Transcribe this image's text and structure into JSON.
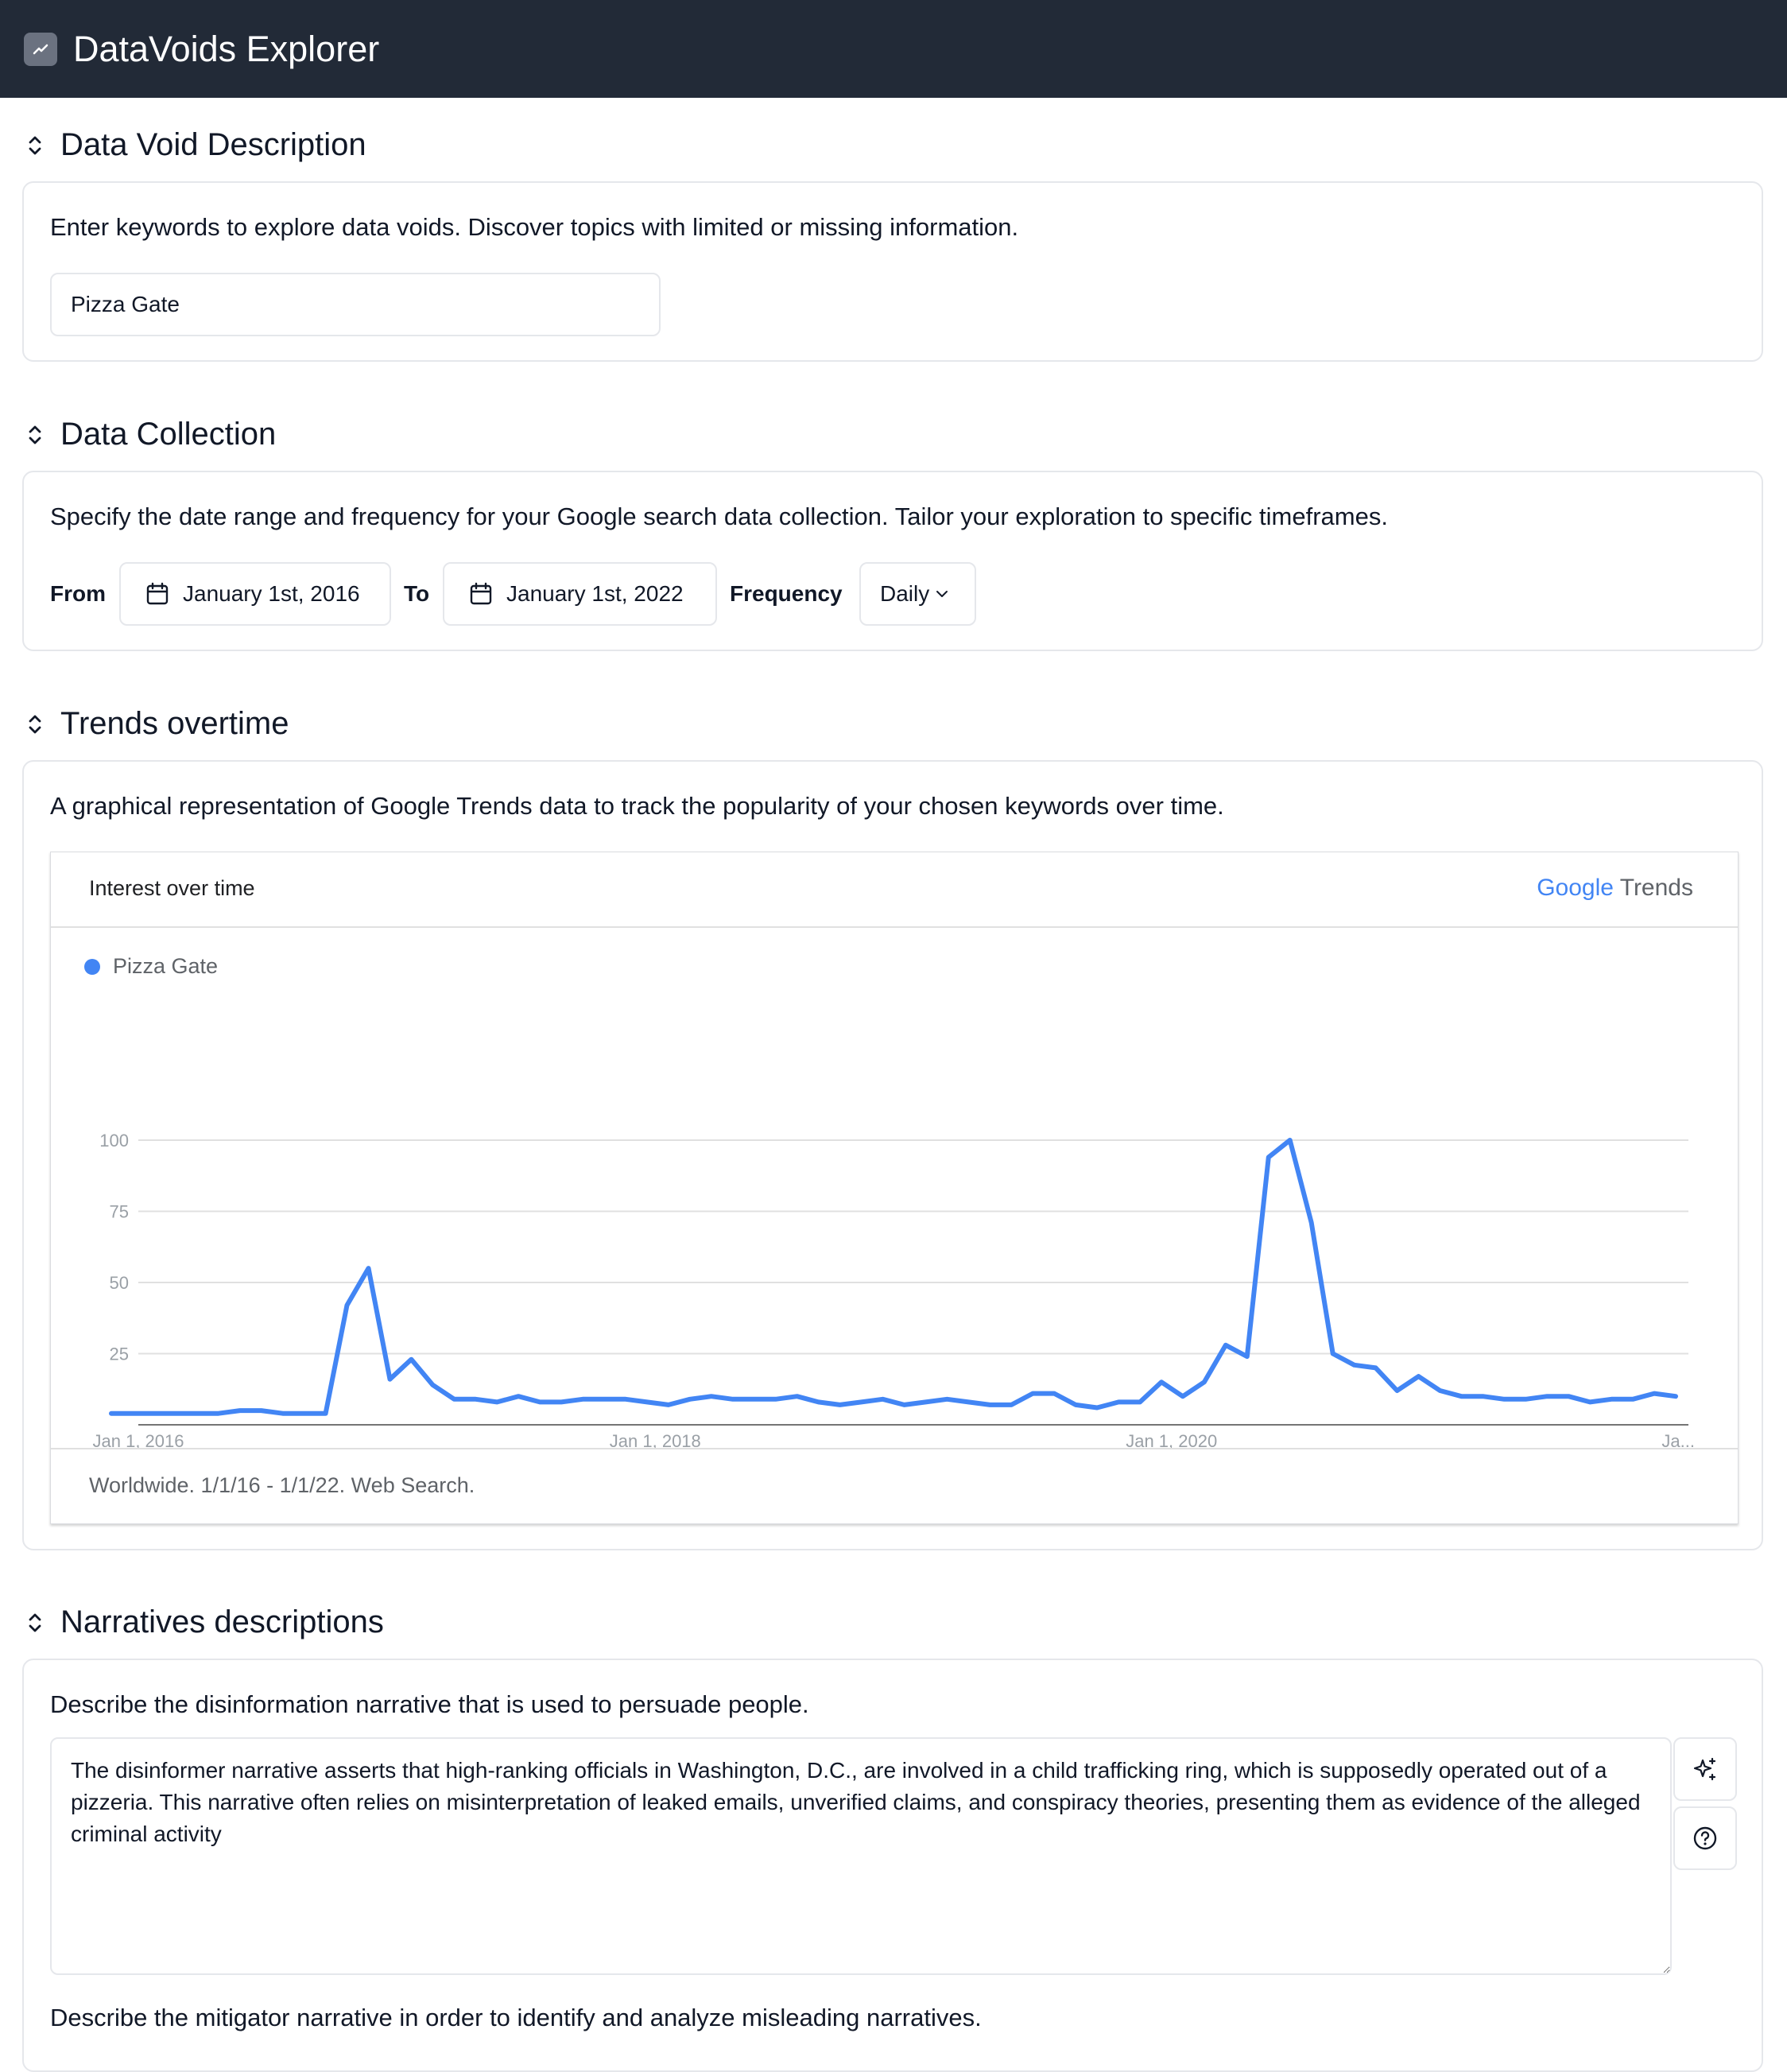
{
  "app": {
    "title": "DataVoids Explorer",
    "logo_icon": "trending-up-icon"
  },
  "sections": {
    "description": {
      "title": "Data Void Description",
      "text": "Enter keywords to explore data voids. Discover topics with limited or missing information.",
      "keyword_value": "Pizza Gate"
    },
    "collection": {
      "title": "Data Collection",
      "text": "Specify the date range and frequency for your Google search data collection. Tailor your exploration to specific timeframes.",
      "from_label": "From",
      "from_value": "January 1st, 2016",
      "to_label": "To",
      "to_value": "January 1st, 2022",
      "frequency_label": "Frequency",
      "frequency_value": "Daily"
    },
    "trends": {
      "title": "Trends overtime",
      "text": "A graphical representation of Google Trends data to track the popularity of your chosen keywords over time.",
      "widget_title": "Interest over time",
      "brand_google": "Google",
      "brand_trends": "Trends",
      "footer": "Worldwide. 1/1/16 - 1/1/22. Web Search."
    },
    "narratives": {
      "title": "Narratives descriptions",
      "text": "Describe the disinformation narrative that is used to persuade people.",
      "disinformer_value": "The disinformer narrative asserts that high-ranking officials in Washington, D.C., are involved in a child trafficking ring, which is supposedly operated out of a pizzeria. This narrative often relies on misinterpretation of leaked emails, unverified claims, and conspiracy theories, presenting them as evidence of the alleged criminal activity",
      "mitigator_text": "Describe the mitigator narrative in order to identify and analyze misleading narratives."
    }
  },
  "chart_data": {
    "type": "line",
    "series": [
      {
        "name": "Pizza Gate",
        "color": "#4285f4",
        "values": [
          4,
          4,
          4,
          4,
          4,
          4,
          5,
          5,
          4,
          4,
          4,
          42,
          55,
          16,
          23,
          14,
          9,
          9,
          8,
          10,
          8,
          8,
          9,
          9,
          9,
          8,
          7,
          9,
          10,
          9,
          9,
          9,
          10,
          8,
          7,
          8,
          9,
          7,
          8,
          9,
          8,
          7,
          7,
          11,
          11,
          7,
          6,
          8,
          8,
          15,
          10,
          15,
          28,
          24,
          94,
          100,
          71,
          25,
          21,
          20,
          12,
          17,
          12,
          10,
          10,
          9,
          9,
          10,
          10,
          8,
          9,
          9,
          11,
          10
        ]
      }
    ],
    "x_ticks": [
      "Jan 1, 2016",
      "Jan 1, 2018",
      "Jan 1, 2020",
      "Ja..."
    ],
    "y_ticks": [
      "100",
      "75",
      "50",
      "25"
    ],
    "ylim": [
      0,
      100
    ],
    "xlim": [
      "2016-01-01",
      "2022-01-01"
    ],
    "x_interval": "monthly",
    "grid": true,
    "legend": "top-left"
  }
}
